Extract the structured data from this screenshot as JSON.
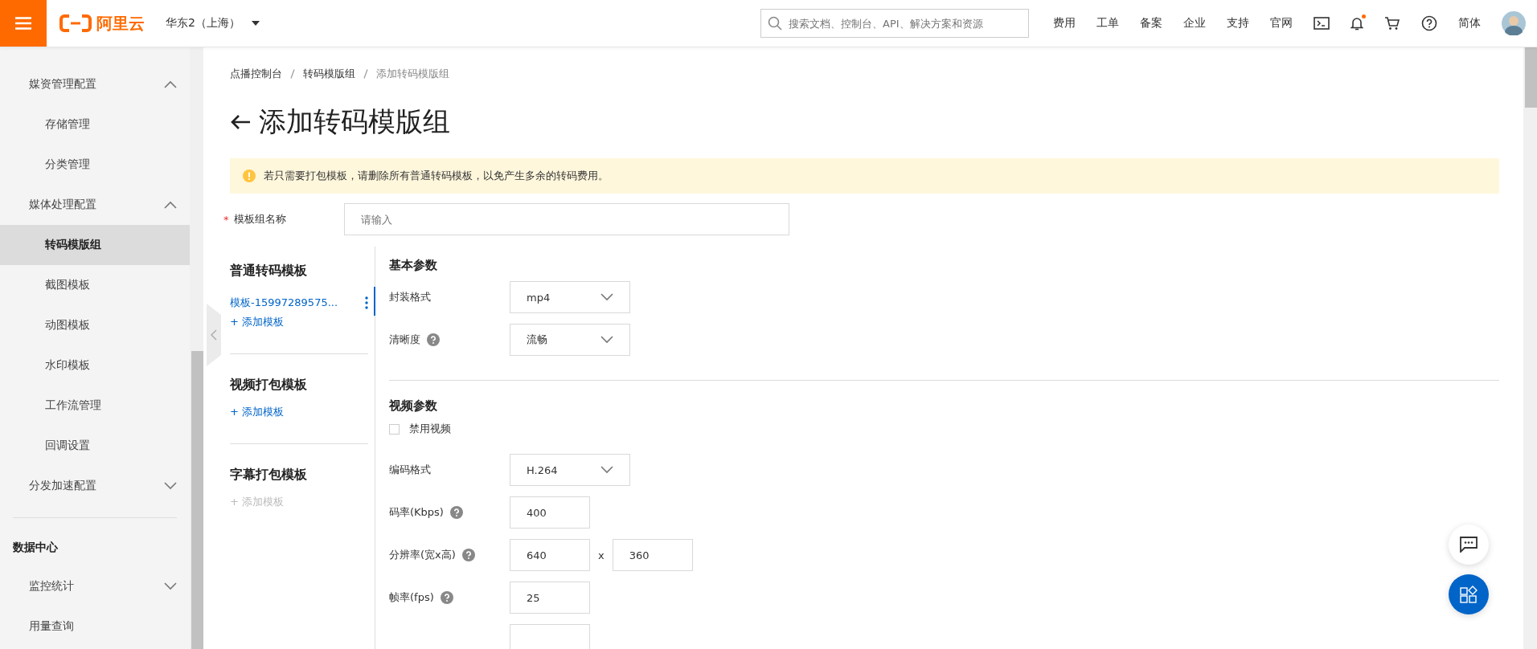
{
  "header": {
    "logo_text": "阿里云",
    "region": "华东2（上海）",
    "search": {
      "placeholder": "搜索文档、控制台、API、解决方案和资源"
    },
    "nav": [
      {
        "kind": "text",
        "label": "费用"
      },
      {
        "kind": "text",
        "label": "工单"
      },
      {
        "kind": "text",
        "label": "备案"
      },
      {
        "kind": "text",
        "label": "企业"
      },
      {
        "kind": "text",
        "label": "支持"
      },
      {
        "kind": "text",
        "label": "官网"
      },
      {
        "kind": "terminal"
      },
      {
        "kind": "bell",
        "unread": true
      },
      {
        "kind": "cart"
      },
      {
        "kind": "help"
      },
      {
        "kind": "text",
        "label": "简体"
      },
      {
        "kind": "avatar"
      }
    ]
  },
  "sidebar": {
    "sections": [
      {
        "items": [
          {
            "kind": "group",
            "label": "媒资管理配置",
            "expanded": true,
            "selected": false,
            "children": [
              {
                "label": "存储管理",
                "selected": false
              },
              {
                "label": "分类管理",
                "selected": false
              }
            ]
          },
          {
            "kind": "group",
            "label": "媒体处理配置",
            "expanded": true,
            "selected": false,
            "children": [
              {
                "label": "转码模版组",
                "selected": true
              },
              {
                "label": "截图模板",
                "selected": false
              },
              {
                "label": "动图模板",
                "selected": false
              },
              {
                "label": "水印模板",
                "selected": false
              },
              {
                "label": "工作流管理",
                "selected": false
              },
              {
                "label": "回调设置",
                "selected": false
              }
            ]
          },
          {
            "kind": "group",
            "label": "分发加速配置",
            "expanded": false,
            "selected": false
          }
        ]
      },
      {
        "title": "数据中心",
        "items": [
          {
            "kind": "group",
            "label": "监控统计",
            "expanded": false,
            "selected": false
          },
          {
            "kind": "link",
            "label": "用量查询",
            "selected": false
          }
        ]
      }
    ]
  },
  "breadcrumb": [
    "点播控制台",
    "转码模版组",
    "添加转码模版组"
  ],
  "title": "添加转码模版组",
  "alert": "若只需要打包模板，请删除所有普通转码模板，以免产生多余的转码费用。",
  "name_field": {
    "label": "模板组名称",
    "required_mark": "*",
    "placeholder": "请输入"
  },
  "template_groups": [
    {
      "title": "普通转码模板",
      "templates": [
        {
          "label": "模板-15997289575...",
          "selected": true
        }
      ],
      "add_label": "+ 添加模板",
      "add_disabled": false
    },
    {
      "title": "视频打包模板",
      "add_label": "+ 添加模板",
      "add_disabled": false
    },
    {
      "title": "字幕打包模板",
      "add_label": "+ 添加模板",
      "add_disabled": true
    }
  ],
  "basic": {
    "title": "基本参数",
    "fields": [
      {
        "kind": "select",
        "label": "封装格式",
        "help": false,
        "value": "mp4"
      },
      {
        "kind": "select",
        "label": "清晰度",
        "help": true,
        "value": "流畅"
      }
    ]
  },
  "video": {
    "title": "视频参数",
    "disable_video": {
      "label": "禁用视频",
      "checked": false
    },
    "fields": [
      {
        "kind": "select",
        "label": "编码格式",
        "help": false,
        "value": "H.264"
      },
      {
        "kind": "input",
        "label": "码率(Kbps)",
        "help": true,
        "value": "400"
      },
      {
        "kind": "pair",
        "label": "分辨率(宽x高)",
        "help": true,
        "value": "640",
        "separator": "x",
        "value2": "360"
      },
      {
        "kind": "input",
        "label": "帧率(fps)",
        "help": true,
        "value": "25"
      },
      {
        "kind": "input",
        "help": false
      }
    ]
  }
}
